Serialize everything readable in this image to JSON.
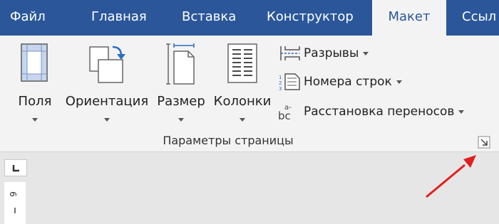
{
  "tabs": [
    {
      "label": "Файл"
    },
    {
      "label": "Главная"
    },
    {
      "label": "Вставка"
    },
    {
      "label": "Конструктор"
    },
    {
      "label": "Макет",
      "active": true
    },
    {
      "label": "Ссыл"
    }
  ],
  "ribbon": {
    "big_buttons": [
      {
        "label": "Поля",
        "icon": "margins-icon"
      },
      {
        "label": "Ориентация",
        "icon": "orientation-icon"
      },
      {
        "label": "Размер",
        "icon": "size-icon"
      },
      {
        "label": "Колонки",
        "icon": "columns-icon"
      }
    ],
    "small_buttons": [
      {
        "label": "Разрывы",
        "icon": "breaks-icon"
      },
      {
        "label": "Номера строк",
        "icon": "line-numbers-icon"
      },
      {
        "label": "Расстановка переносов",
        "icon": "hyphenation-icon",
        "icon_text": "bc",
        "icon_sup": "a-"
      }
    ],
    "group_label": "Параметры страницы",
    "launcher_icon": "dialog-launcher-icon"
  },
  "ruler": {
    "corner_icon": "tab-stop-icon",
    "number": "6"
  },
  "colors": {
    "tabbar": "#2b579a",
    "ribbon": "#f3f3f3",
    "annotation_arrow": "#e02020"
  }
}
